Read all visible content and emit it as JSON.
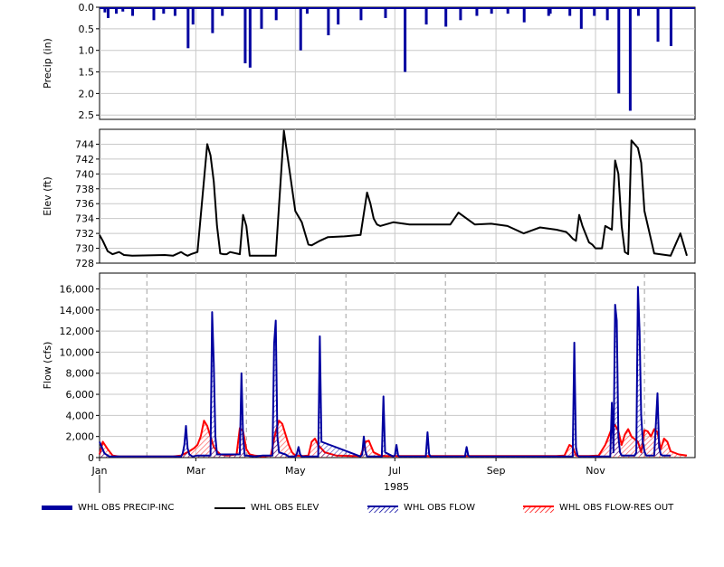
{
  "chart_data": [
    {
      "type": "bar",
      "ylabel": "Precip (in)",
      "ylim": [
        2.6,
        0.0
      ],
      "inverted": true,
      "yticks": [
        "0.0",
        "0.5",
        "1.0",
        "1.5",
        "2.0",
        "2.5"
      ],
      "ytick_values": [
        0.0,
        0.5,
        1.0,
        1.5,
        2.0,
        2.5
      ],
      "grid": true,
      "series": [
        {
          "name": "WHL OBS PRECIP-INC",
          "color": "#0000a0",
          "x_day": [
            3,
            5,
            10,
            14,
            20,
            33,
            39,
            46,
            54,
            57,
            69,
            75,
            89,
            92,
            99,
            108,
            123,
            127,
            140,
            146,
            160,
            175,
            187,
            200,
            212,
            221,
            231,
            240,
            250,
            260,
            275,
            276,
            288,
            295,
            303,
            311,
            318,
            325,
            330,
            342,
            350
          ],
          "values": [
            0.12,
            0.25,
            0.15,
            0.1,
            0.2,
            0.3,
            0.15,
            0.2,
            0.95,
            0.4,
            0.6,
            0.2,
            1.3,
            1.4,
            0.5,
            0.3,
            1.0,
            0.15,
            0.65,
            0.4,
            0.3,
            0.25,
            1.5,
            0.4,
            0.45,
            0.3,
            0.2,
            0.15,
            0.15,
            0.35,
            0.2,
            0.15,
            0.2,
            0.5,
            0.2,
            0.3,
            2.0,
            2.4,
            0.2,
            0.8,
            0.9
          ]
        }
      ]
    },
    {
      "type": "line",
      "ylabel": "Elev (ft)",
      "ylim": [
        728,
        746
      ],
      "yticks": [
        "728",
        "730",
        "732",
        "734",
        "736",
        "738",
        "740",
        "742",
        "744"
      ],
      "ytick_values": [
        728,
        730,
        732,
        734,
        736,
        738,
        740,
        742,
        744
      ],
      "grid": true,
      "series": [
        {
          "name": "WHL OBS ELEV",
          "color": "#000000",
          "x_day": [
            0,
            2,
            5,
            8,
            12,
            15,
            20,
            40,
            45,
            50,
            52,
            54,
            56,
            60,
            66,
            68,
            70,
            72,
            74,
            76,
            78,
            80,
            86,
            88,
            90,
            92,
            94,
            96,
            98,
            100,
            102,
            104,
            108,
            113,
            120,
            124,
            126,
            128,
            130,
            135,
            140,
            150,
            160,
            164,
            166,
            168,
            170,
            172,
            180,
            190,
            200,
            210,
            215,
            220,
            230,
            240,
            250,
            260,
            270,
            280,
            286,
            288,
            290,
            292,
            294,
            296,
            300,
            302,
            304,
            306,
            308,
            310,
            314,
            316,
            318,
            320,
            322,
            324,
            326,
            330,
            332,
            334,
            340,
            350,
            356,
            360
          ],
          "values": [
            731.8,
            731.0,
            729.6,
            729.2,
            729.5,
            729.1,
            729.0,
            729.1,
            729.0,
            729.5,
            729.2,
            729.0,
            729.2,
            729.5,
            744.0,
            742.5,
            739.0,
            733.0,
            729.3,
            729.2,
            729.2,
            729.5,
            729.2,
            734.5,
            733.0,
            729.0,
            729.0,
            729.0,
            729.0,
            729.0,
            729.0,
            729.0,
            729.0,
            745.8,
            735.0,
            733.5,
            732.0,
            730.5,
            730.4,
            731.0,
            731.5,
            731.6,
            731.8,
            737.5,
            736.0,
            734.0,
            733.2,
            733.0,
            733.5,
            733.2,
            733.2,
            733.2,
            733.2,
            734.8,
            733.2,
            733.3,
            733.0,
            732.0,
            732.8,
            732.5,
            732.2,
            731.8,
            731.3,
            731.0,
            734.5,
            733.0,
            730.8,
            730.5,
            730.0,
            730.0,
            730.0,
            733.0,
            732.5,
            741.8,
            740.0,
            733.0,
            729.5,
            729.2,
            744.5,
            743.5,
            741.5,
            735.0,
            729.3,
            729.0,
            732.0,
            729.0,
            729.0,
            729.0
          ]
        }
      ]
    },
    {
      "type": "line",
      "ylabel": "Flow (cfs)",
      "xlabel": "1985",
      "ylim": [
        0,
        17500
      ],
      "yticks": [
        "0",
        "2,000",
        "4,000",
        "6,000",
        "8,000",
        "10,000",
        "12,000",
        "14,000",
        "16,000"
      ],
      "ytick_values": [
        0,
        2000,
        4000,
        6000,
        8000,
        10000,
        12000,
        14000,
        16000
      ],
      "xticks": [
        "Jan",
        "Mar",
        "May",
        "Jul",
        "Sep",
        "Nov"
      ],
      "xtick_days": [
        0,
        59,
        120,
        181,
        243,
        304
      ],
      "grid": true,
      "series": [
        {
          "name": "WHL OBS FLOW",
          "color": "#0000a0",
          "x_day": [
            0,
            3,
            6,
            9,
            50,
            51,
            52,
            53,
            54,
            55,
            56,
            57,
            60,
            68,
            69,
            70,
            71,
            72,
            86,
            87,
            88,
            89,
            90,
            95,
            100,
            106,
            107,
            108,
            109,
            110,
            114,
            116,
            120,
            121,
            122,
            123,
            124,
            126,
            134,
            135,
            136,
            160,
            161,
            162,
            163,
            164,
            168,
            173,
            174,
            175,
            180,
            181,
            182,
            183,
            184,
            200,
            201,
            202,
            203,
            224,
            225,
            226,
            227,
            228,
            270,
            280,
            290,
            291,
            292,
            293,
            294,
            300,
            313,
            314,
            315,
            316,
            317,
            318,
            319,
            320,
            321,
            328,
            329,
            330,
            331,
            332,
            333,
            334,
            335,
            340,
            342,
            343,
            344,
            345,
            350,
            360
          ],
          "values": [
            1500,
            400,
            100,
            100,
            100,
            400,
            1200,
            3000,
            900,
            300,
            200,
            100,
            200,
            200,
            13800,
            9000,
            2000,
            300,
            300,
            8000,
            2000,
            200,
            200,
            100,
            200,
            200,
            10800,
            13000,
            2000,
            500,
            300,
            100,
            100,
            400,
            1000,
            300,
            100,
            100,
            100,
            11500,
            1500,
            100,
            300,
            2000,
            600,
            100,
            100,
            100,
            5800,
            500,
            100,
            200,
            1200,
            200,
            100,
            100,
            2400,
            300,
            100,
            100,
            1000,
            200,
            100,
            100,
            100,
            100,
            100,
            10900,
            1000,
            200,
            100,
            100,
            100,
            5200,
            500,
            14500,
            13000,
            2000,
            500,
            200,
            200,
            200,
            500,
            16200,
            12000,
            4000,
            1500,
            600,
            200,
            200,
            6100,
            1000,
            300,
            200,
            200
          ]
        },
        {
          "name": "WHL OBS FLOW-RES OUT",
          "color": "#ff0000",
          "x_day": [
            0,
            2,
            5,
            8,
            12,
            20,
            40,
            45,
            50,
            55,
            58,
            60,
            62,
            64,
            66,
            68,
            70,
            72,
            74,
            78,
            84,
            86,
            88,
            90,
            92,
            95,
            100,
            105,
            108,
            110,
            112,
            114,
            116,
            118,
            120,
            125,
            128,
            130,
            132,
            134,
            138,
            145,
            155,
            160,
            163,
            165,
            168,
            172,
            175,
            180,
            190,
            200,
            210,
            220,
            230,
            240,
            250,
            260,
            270,
            280,
            285,
            288,
            290,
            292,
            294,
            300,
            306,
            308,
            310,
            312,
            314,
            316,
            318,
            320,
            322,
            324,
            326,
            330,
            332,
            334,
            336,
            338,
            340,
            342,
            344,
            346,
            348,
            350,
            355,
            360
          ],
          "values": [
            300,
            1500,
            800,
            200,
            100,
            100,
            100,
            100,
            200,
            600,
            900,
            1200,
            2000,
            3500,
            3000,
            2000,
            1000,
            600,
            300,
            200,
            300,
            2800,
            2500,
            800,
            300,
            200,
            100,
            200,
            2500,
            3500,
            3200,
            2200,
            1200,
            500,
            200,
            150,
            200,
            1500,
            1800,
            1200,
            500,
            200,
            150,
            150,
            1500,
            1600,
            500,
            200,
            150,
            150,
            150,
            150,
            150,
            150,
            150,
            150,
            150,
            150,
            150,
            150,
            200,
            1200,
            1000,
            200,
            150,
            150,
            200,
            700,
            1200,
            2000,
            2800,
            3100,
            2500,
            1200,
            2200,
            2700,
            2000,
            1500,
            500,
            2600,
            2500,
            2000,
            2700,
            2400,
            800,
            1800,
            1500,
            600,
            300,
            200
          ]
        }
      ]
    }
  ],
  "legend": [
    {
      "label": "WHL OBS PRECIP-INC",
      "color": "#0000a0",
      "style": "thick"
    },
    {
      "label": "WHL OBS ELEV",
      "color": "#000000",
      "style": "line"
    },
    {
      "label": "WHL OBS FLOW",
      "color": "#0000a0",
      "style": "hatch"
    },
    {
      "label": "WHL OBS FLOW-RES OUT",
      "color": "#ff0000",
      "style": "hatch"
    }
  ]
}
